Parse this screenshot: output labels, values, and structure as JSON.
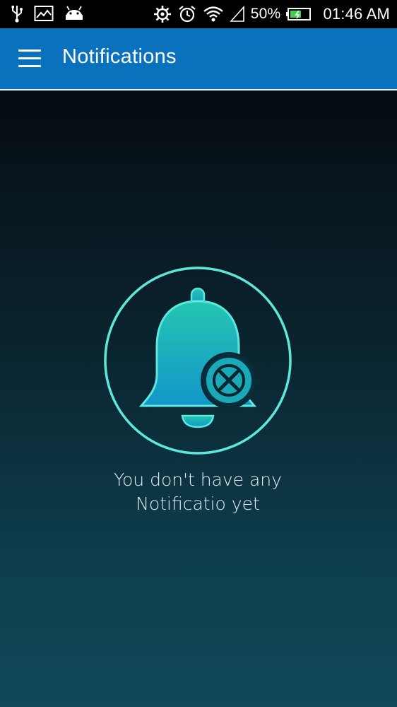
{
  "status_bar": {
    "battery_percent": "50%",
    "time": "01:46 AM",
    "left_icons": [
      "usb-icon",
      "gallery-icon",
      "android-icon"
    ],
    "right_icons": [
      "settings-icon",
      "alarm-icon",
      "wifi-icon",
      "signal-icon",
      "battery-icon"
    ]
  },
  "app_bar": {
    "title": "Notifications",
    "menu_icon": "hamburger-menu-icon",
    "color": "#0a72bd"
  },
  "empty_state": {
    "icon": "bell-off-icon",
    "message_line1": "You don't have any",
    "message_line2": "Notificatio yet",
    "accent_color": "#5ce8dc"
  }
}
